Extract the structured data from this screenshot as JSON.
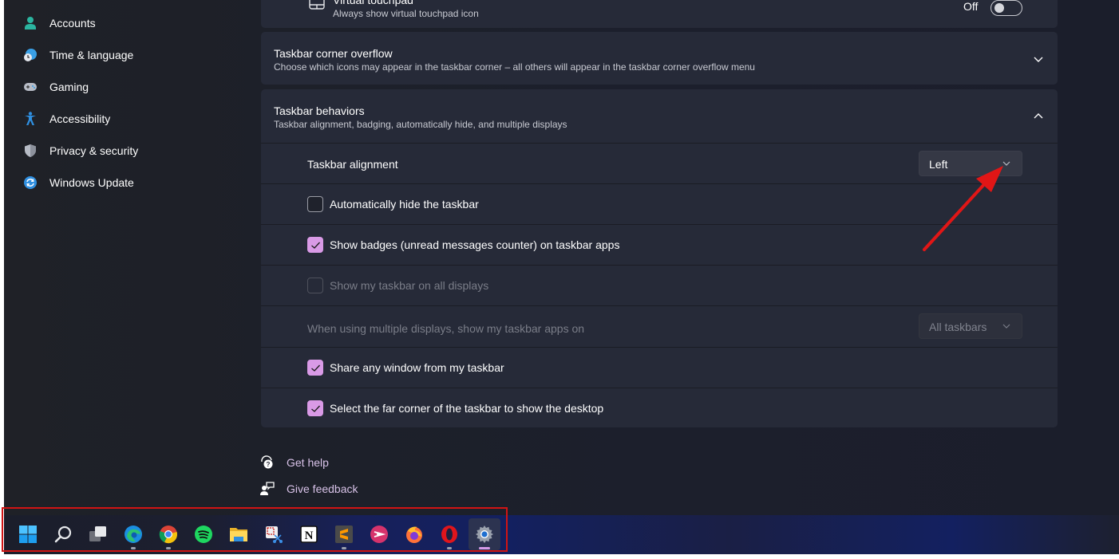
{
  "sidebar": {
    "items": [
      {
        "label": "Accounts",
        "icon": "person-icon",
        "color": "#2bb5a0"
      },
      {
        "label": "Time & language",
        "icon": "globe-clock-icon",
        "color": "#3aa0e6"
      },
      {
        "label": "Gaming",
        "icon": "gamepad-icon",
        "color": "#b7bcc6"
      },
      {
        "label": "Accessibility",
        "icon": "accessibility-icon",
        "color": "#2f8fe0"
      },
      {
        "label": "Privacy & security",
        "icon": "shield-icon",
        "color": "#b7bcc6"
      },
      {
        "label": "Windows Update",
        "icon": "sync-icon",
        "color": "#2f8fe0"
      }
    ]
  },
  "virtual_touchpad": {
    "title": "Virtual touchpad",
    "subtitle": "Always show virtual touchpad icon",
    "toggle_label": "Off",
    "toggle_on": false
  },
  "corner_overflow": {
    "title": "Taskbar corner overflow",
    "subtitle": "Choose which icons may appear in the taskbar corner – all others will appear in the taskbar corner overflow menu",
    "expanded": false
  },
  "behaviors": {
    "title": "Taskbar behaviors",
    "subtitle": "Taskbar alignment, badging, automatically hide, and multiple displays",
    "expanded": true,
    "alignment": {
      "label": "Taskbar alignment",
      "value": "Left"
    },
    "auto_hide": {
      "label": "Automatically hide the taskbar",
      "checked": false
    },
    "badges": {
      "label": "Show badges (unread messages counter) on taskbar apps",
      "checked": true
    },
    "all_displays": {
      "label": "Show my taskbar on all displays",
      "checked": false,
      "disabled": true
    },
    "multi_display": {
      "label": "When using multiple displays, show my taskbar apps on",
      "value": "All taskbars",
      "disabled": true
    },
    "share_window": {
      "label": "Share any window from my taskbar",
      "checked": true
    },
    "far_corner": {
      "label": "Select the far corner of the taskbar to show the desktop",
      "checked": true
    }
  },
  "footer": {
    "get_help": "Get help",
    "give_feedback": "Give feedback"
  },
  "taskbar": {
    "items": [
      {
        "name": "start",
        "running": false
      },
      {
        "name": "search",
        "running": false
      },
      {
        "name": "task-view",
        "running": false
      },
      {
        "name": "edge",
        "running": true
      },
      {
        "name": "chrome",
        "running": true
      },
      {
        "name": "spotify",
        "running": false
      },
      {
        "name": "file-explorer",
        "running": false
      },
      {
        "name": "snipping-tool",
        "running": false
      },
      {
        "name": "notion",
        "running": false
      },
      {
        "name": "sublime-text",
        "running": true
      },
      {
        "name": "app-pink",
        "running": false
      },
      {
        "name": "firefox",
        "running": false
      },
      {
        "name": "opera",
        "running": true
      },
      {
        "name": "settings",
        "running": true,
        "active": true
      }
    ]
  },
  "colors": {
    "accent": "#d99ae6",
    "annotation": "#d11414"
  }
}
